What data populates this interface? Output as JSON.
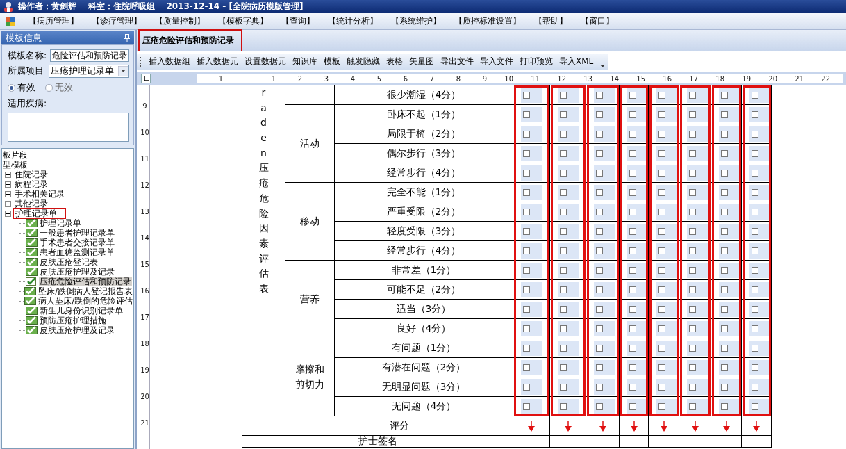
{
  "window": {
    "title": "操作者：黄剑辉    科室：住院呼吸组    2013-12-14 - [全院病历模版管理]"
  },
  "menu": [
    "【病历管理】",
    "【诊疗管理】",
    "【质量控制】",
    "【模板字典】",
    "【查询】",
    "【统计分析】",
    "【系统维护】",
    "【质控标准设置】",
    "【帮助】",
    "【窗口】"
  ],
  "left_panel": {
    "title": "模板信息",
    "name_label": "模板名称:",
    "name_value": "危险评估和预防记录",
    "category_label": "所属项目",
    "category_value": "压疮护理记录单",
    "radios": [
      {
        "label": "有效",
        "selected": true
      },
      {
        "label": "无效",
        "selected": false
      }
    ],
    "disease_label": "适用疾病:",
    "tree": [
      {
        "label": "板片段"
      },
      {
        "label": "型模板",
        "children": [
          {
            "label": "住院记录",
            "expanded": false
          },
          {
            "label": "病程记录",
            "expanded": false
          },
          {
            "label": "手术相关记录",
            "expanded": false
          },
          {
            "label": "其他记录",
            "expanded": false
          },
          {
            "label": "护理记录单",
            "expanded": true,
            "annotated": true,
            "children": [
              {
                "label": "护理记录单",
                "selected": false
              },
              {
                "label": "一般患者护理记录单",
                "selected": false
              },
              {
                "label": "手术患者交接记录单",
                "selected": false
              },
              {
                "label": "患者血糖监测记录单",
                "selected": false
              },
              {
                "label": "皮肤压疮登记表",
                "selected": false
              },
              {
                "label": "皮肤压疮护理及记录",
                "selected": false
              },
              {
                "label": "压疮危险评估和预防记录",
                "selected": true
              },
              {
                "label": "坠床/跌倒病人登记报告表",
                "selected": false
              },
              {
                "label": "病人坠床/跌倒的危险评估",
                "selected": false
              },
              {
                "label": "新生儿身份识别记录单",
                "selected": false
              },
              {
                "label": "预防压疮护理措施",
                "selected": false
              },
              {
                "label": "皮肤压疮护理及记录",
                "selected": false
              }
            ]
          }
        ]
      }
    ]
  },
  "doc_tab": {
    "title": "压疮危险评估和预防记录",
    "annotated": true
  },
  "toolbar": [
    "插入数据组",
    "插入数据元",
    "设置数据元",
    "知识库",
    "模板",
    "触发隐藏",
    "表格",
    "矢量图",
    "导出文件",
    "导入文件",
    "打印预览",
    "导入XML"
  ],
  "ruler": {
    "horizontal": [
      "1",
      "1",
      "2",
      "3",
      "4",
      "5",
      "6",
      "7",
      "8",
      "9",
      "10",
      "11",
      "12",
      "13",
      "14",
      "15",
      "16",
      "17",
      "18",
      "19",
      "20",
      "21",
      "22"
    ],
    "vertical": [
      "9",
      "10",
      "11",
      "12",
      "13",
      "14",
      "15",
      "16",
      "17",
      "18",
      "19",
      "20",
      "21"
    ]
  },
  "table": {
    "title_column": "raden压疮危险因素评估表",
    "groups": [
      {
        "items": [
          {
            "label": "很少潮湿（4分）",
            "checks": [
              false,
              false,
              false,
              false,
              false,
              false,
              false,
              false
            ]
          }
        ]
      },
      {
        "name": "活动",
        "items": [
          {
            "label": "卧床不起（1分）",
            "checks": [
              false,
              false,
              false,
              false,
              false,
              false,
              false,
              false
            ]
          },
          {
            "label": "局限于椅（2分）",
            "checks": [
              false,
              false,
              false,
              false,
              false,
              false,
              false,
              false
            ]
          },
          {
            "label": "偶尔步行（3分）",
            "checks": [
              false,
              false,
              false,
              false,
              false,
              false,
              false,
              false
            ]
          },
          {
            "label": "经常步行（4分）",
            "checks": [
              false,
              false,
              false,
              false,
              false,
              false,
              false,
              false
            ]
          }
        ]
      },
      {
        "name": "移动",
        "items": [
          {
            "label": "完全不能（1分）",
            "checks": [
              false,
              false,
              false,
              false,
              false,
              false,
              false,
              false
            ]
          },
          {
            "label": "严重受限（2分）",
            "checks": [
              false,
              false,
              false,
              false,
              false,
              false,
              false,
              false
            ]
          },
          {
            "label": "轻度受限（3分）",
            "checks": [
              false,
              false,
              false,
              false,
              false,
              false,
              false,
              false
            ]
          },
          {
            "label": "经常步行（4分）",
            "checks": [
              false,
              false,
              false,
              false,
              false,
              false,
              false,
              false
            ]
          }
        ]
      },
      {
        "name": "营养",
        "items": [
          {
            "label": "非常差（1分）",
            "checks": [
              false,
              false,
              false,
              false,
              false,
              false,
              false,
              false
            ]
          },
          {
            "label": "可能不足（2分）",
            "checks": [
              false,
              false,
              false,
              false,
              false,
              false,
              false,
              false
            ]
          },
          {
            "label": "适当（3分）",
            "checks": [
              false,
              false,
              false,
              false,
              false,
              false,
              false,
              false
            ]
          },
          {
            "label": "良好（4分）",
            "checks": [
              false,
              false,
              false,
              false,
              false,
              false,
              false,
              false
            ]
          }
        ]
      },
      {
        "name": "摩擦和剪切力",
        "items": [
          {
            "label": "有问题（1分）",
            "checks": [
              false,
              false,
              false,
              false,
              false,
              false,
              false,
              false
            ]
          },
          {
            "label": "有潜在问题（2分）",
            "checks": [
              false,
              false,
              false,
              false,
              false,
              false,
              false,
              false
            ]
          },
          {
            "label": "无明显问题（3分）",
            "checks": [
              false,
              false,
              false,
              false,
              false,
              false,
              false,
              false
            ]
          },
          {
            "label": "无问题（4分）",
            "checks": [
              false,
              false,
              false,
              false,
              false,
              false,
              false,
              false
            ]
          }
        ]
      }
    ],
    "score_label": "评分",
    "signature_label": "护士签名",
    "check_columns": [
      {
        "annotated": true
      },
      {
        "annotated": true
      },
      {
        "annotated": true
      },
      {
        "annotated": true
      },
      {
        "annotated": true
      },
      {
        "annotated": true
      },
      {
        "annotated": true
      },
      {
        "annotated": true
      }
    ]
  }
}
